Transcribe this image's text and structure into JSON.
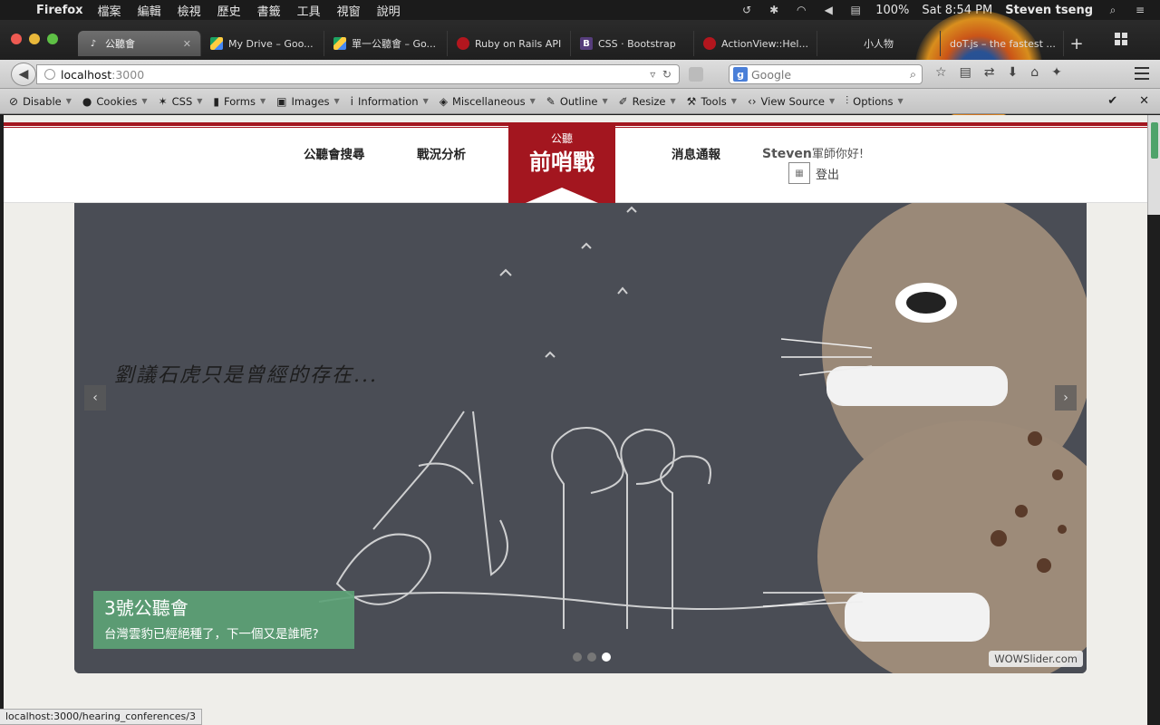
{
  "menubar": {
    "app": "Firefox",
    "items": [
      "檔案",
      "編輯",
      "檢視",
      "歷史",
      "書籤",
      "工具",
      "視窗",
      "說明"
    ],
    "battery": "100%",
    "clock": "Sat 8:54 PM",
    "user": "Steven tseng"
  },
  "tabs": [
    {
      "label": "公聽會",
      "icon": "music-note-icon"
    },
    {
      "label": "My Drive – Goo...",
      "icon": "google-drive-icon"
    },
    {
      "label": "單一公聽會 – Go...",
      "icon": "google-drive-icon"
    },
    {
      "label": "Ruby on Rails API",
      "icon": "ruby-icon"
    },
    {
      "label": "CSS · Bootstrap",
      "icon": "bootstrap-icon"
    },
    {
      "label": "ActionView::Hel...",
      "icon": "ruby-icon"
    },
    {
      "label": "小人物",
      "icon": ""
    },
    {
      "label": "doT.js – the fastest ...",
      "icon": ""
    }
  ],
  "navbar": {
    "url_host": "localhost",
    "url_port": ":3000",
    "search_placeholder": "Google"
  },
  "devbar": [
    {
      "label": "Disable",
      "icon": "disable-icon"
    },
    {
      "label": "Cookies",
      "icon": "cookie-person-icon"
    },
    {
      "label": "CSS",
      "icon": "css-wand-icon"
    },
    {
      "label": "Forms",
      "icon": "forms-clipboard-icon"
    },
    {
      "label": "Images",
      "icon": "image-icon"
    },
    {
      "label": "Information",
      "icon": "info-icon"
    },
    {
      "label": "Miscellaneous",
      "icon": "cube-icon"
    },
    {
      "label": "Outline",
      "icon": "pencil-icon"
    },
    {
      "label": "Resize",
      "icon": "resize-icon"
    },
    {
      "label": "Tools",
      "icon": "wrench-icon"
    },
    {
      "label": "View Source",
      "icon": "code-icon"
    },
    {
      "label": "Options",
      "icon": "options-icon"
    }
  ],
  "site": {
    "nav_left": [
      "公聽會搜尋",
      "戰況分析"
    ],
    "nav_right": "消息通報",
    "logo_small": "公聽",
    "logo_big": "前哨戰",
    "greeting_name": "Steven",
    "greeting_rest": "軍師你好!",
    "logout": "登出"
  },
  "slider": {
    "handwriting": "劉議石虎只是曾經的存在...",
    "caption_title": "3號公聽會",
    "caption_sub": "台灣雲豹已經絕種了，下一個又是誰呢?",
    "slides": 3,
    "active_slide": 3,
    "credit": "WOWSlider.com",
    "prev": "‹",
    "next": "›"
  },
  "status_url": "localhost:3000/hearing_conferences/3"
}
